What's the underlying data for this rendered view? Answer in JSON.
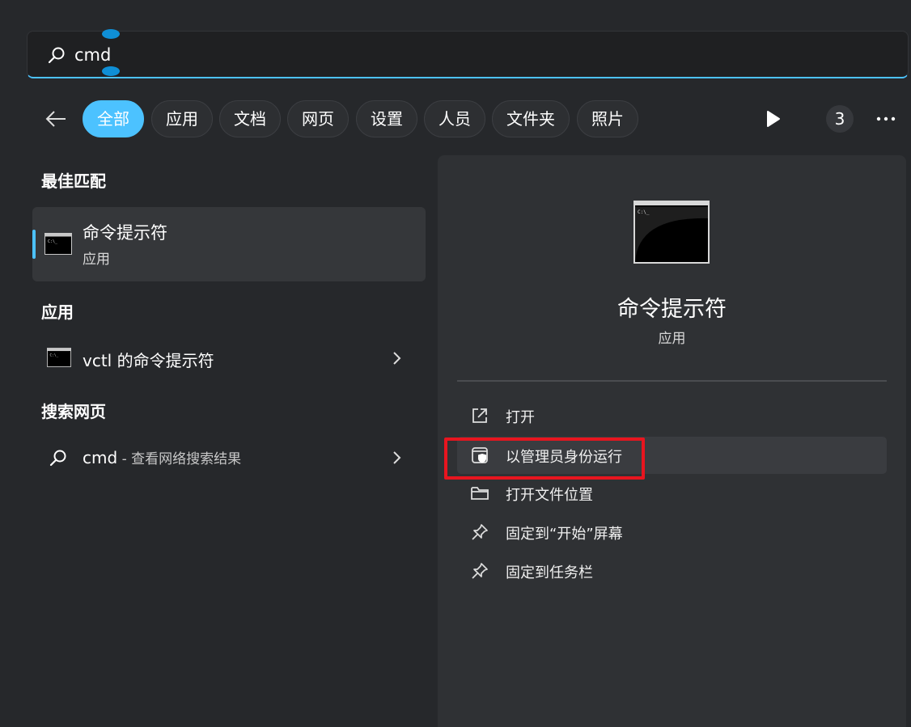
{
  "search": {
    "value": "cmd"
  },
  "filters": [
    "全部",
    "应用",
    "文档",
    "网页",
    "设置",
    "人员",
    "文件夹",
    "照片"
  ],
  "filter_count": "3",
  "sections": {
    "best_match": "最佳匹配",
    "apps": "应用",
    "web": "搜索网页"
  },
  "best_match": {
    "name": "命令提示符",
    "type": "应用"
  },
  "apps_results": [
    {
      "name": "vctl 的命令提示符"
    }
  ],
  "web_results": [
    {
      "query": "cmd",
      "suffix": " - 查看网络搜索结果"
    }
  ],
  "detail": {
    "name": "命令提示符",
    "type": "应用",
    "actions": [
      "打开",
      "以管理员身份运行",
      "打开文件位置",
      "固定到“开始”屏幕",
      "固定到任务栏"
    ]
  },
  "colors": {
    "accent": "#4cc2ff",
    "highlight": "#e8151f"
  }
}
